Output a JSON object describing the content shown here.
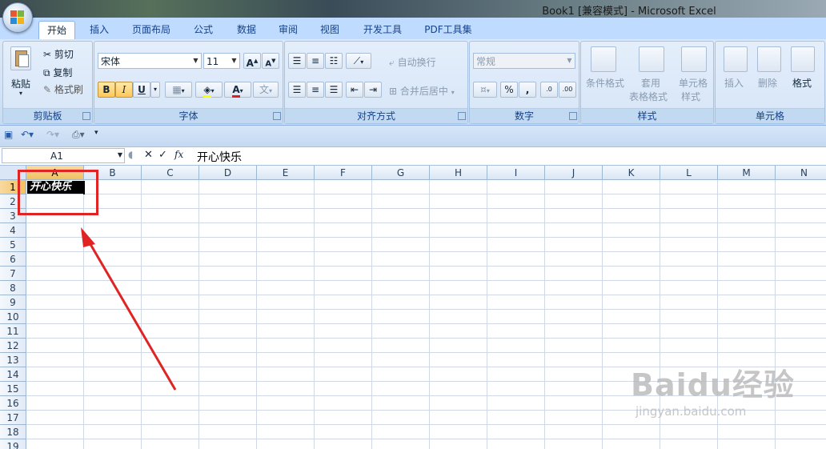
{
  "window": {
    "title": "Book1  [兼容模式] - Microsoft Excel"
  },
  "tabs": [
    {
      "label": "开始",
      "active": true
    },
    {
      "label": "插入"
    },
    {
      "label": "页面布局"
    },
    {
      "label": "公式"
    },
    {
      "label": "数据"
    },
    {
      "label": "审阅"
    },
    {
      "label": "视图"
    },
    {
      "label": "开发工具"
    },
    {
      "label": "PDF工具集"
    }
  ],
  "ribbon": {
    "clipboard": {
      "label": "剪贴板",
      "paste": "粘贴",
      "cut": "剪切",
      "copy": "复制",
      "format_painter": "格式刷"
    },
    "font": {
      "label": "字体",
      "font_name": "宋体",
      "font_size": "11",
      "bold": "B",
      "italic": "I",
      "underline": "U",
      "grow": "A",
      "shrink": "A",
      "font_color": "A"
    },
    "alignment": {
      "label": "对齐方式",
      "wrap": "自动换行",
      "merge": "合并后居中"
    },
    "number": {
      "label": "数字",
      "format": "常规",
      "percent": "%",
      "comma": ","
    },
    "styles": {
      "label": "样式",
      "conditional": "条件格式",
      "table_format_1": "套用",
      "table_format_2": "表格格式",
      "cell_styles_1": "单元格",
      "cell_styles_2": "样式"
    },
    "cells": {
      "label": "单元格",
      "insert": "插入",
      "delete": "删除",
      "format": "格式"
    }
  },
  "formula_bar": {
    "name_box": "A1",
    "fx": "fx",
    "content": "开心快乐"
  },
  "sheet": {
    "columns": [
      "A",
      "B",
      "C",
      "D",
      "E",
      "F",
      "G",
      "H",
      "I",
      "J",
      "K",
      "L",
      "M",
      "N"
    ],
    "rows": [
      "1",
      "2",
      "3",
      "4",
      "5",
      "6",
      "7",
      "8",
      "9",
      "10",
      "11",
      "12",
      "13",
      "14",
      "15",
      "16",
      "17",
      "18",
      "19"
    ],
    "selected_cell": "A1",
    "cell_a1": "开心快乐"
  },
  "watermark": {
    "brand": "Baidu经验",
    "url": "jingyan.baidu.com"
  },
  "colors": {
    "accent_red": "#e02424",
    "ribbon_blue": "#bfdbff",
    "selected_header": "#f1c15f"
  }
}
